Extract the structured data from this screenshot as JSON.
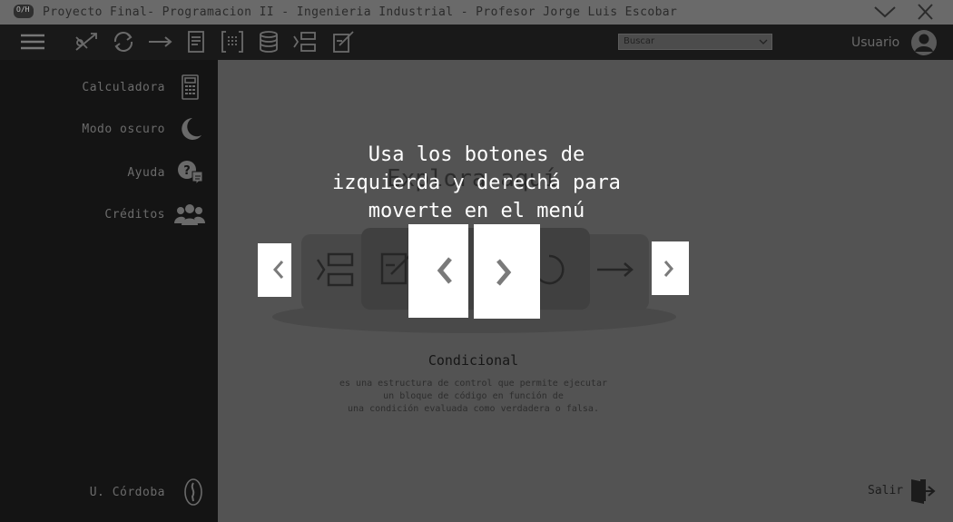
{
  "window": {
    "app_icon_text": "O/H",
    "title": "Proyecto Final- Programacion II - Ingenieria Industrial - Profesor Jorge Luis Escobar",
    "minimize_icon": "chevron-down-icon",
    "close_icon": "close-icon"
  },
  "toolbar": {
    "icons": [
      "menu-icon",
      "variable-icon",
      "loop-icon",
      "arrow-right-icon",
      "document-icon",
      "array-icon",
      "database-icon",
      "conditional-icon",
      "edit-icon"
    ],
    "search": {
      "value": "Buscar"
    },
    "user_label": "Usuario"
  },
  "sidebar": {
    "items": [
      {
        "label": "Calculadora",
        "icon": "calculator-icon"
      },
      {
        "label": "Modo oscuro",
        "icon": "moon-icon"
      },
      {
        "label": "Ayuda",
        "icon": "help-chat-icon"
      },
      {
        "label": "Créditos",
        "icon": "people-icon"
      }
    ],
    "footer": {
      "label": "U. Córdoba",
      "icon": "university-icon"
    }
  },
  "main": {
    "background_title": "Explora aquí",
    "concept": {
      "title": "Condicional",
      "description": "es una estructura de control que permite ejecutar\nun bloque de código en función de\nuna condición evaluada como verdadera o falsa."
    },
    "exit_label": "Salir"
  },
  "tutorial": {
    "text": "Usa los botones de\nizquierda y derechá para\nmoverte en el menú"
  },
  "colors": {
    "sidebar_bg": "#141414",
    "toolbar_bg": "#191919",
    "main_bg": "#535353",
    "overlay_text": "#ffffff"
  }
}
